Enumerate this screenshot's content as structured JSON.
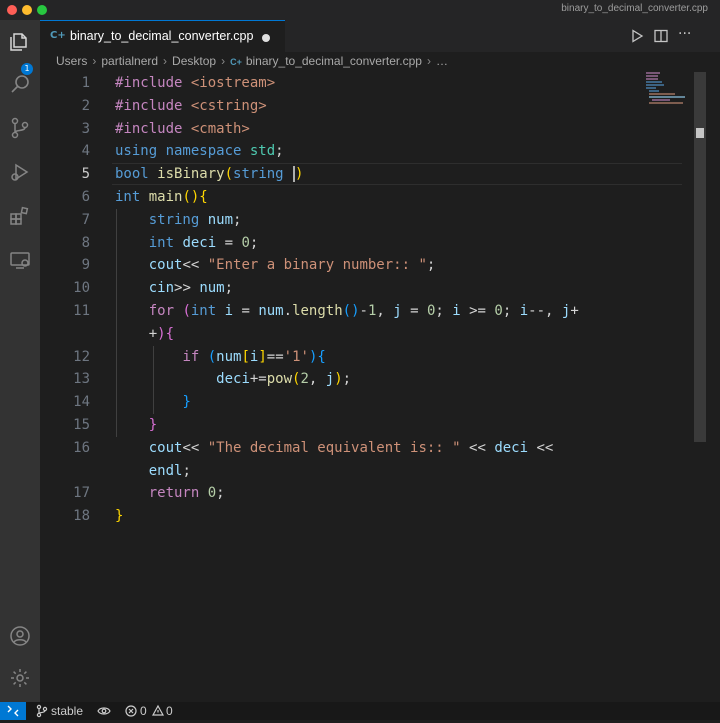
{
  "window": {
    "title": "binary_to_decimal_converter.cpp"
  },
  "activity_bar": {
    "explorer_badge": "1"
  },
  "tab": {
    "lang_icon": "C+",
    "label": "binary_to_decimal_converter.cpp",
    "dirty": true
  },
  "toolbar": {
    "more_label": "···"
  },
  "breadcrumb": {
    "items": [
      "Users",
      "partialnerd",
      "Desktop",
      "binary_to_decimal_converter.cpp",
      "…"
    ],
    "file_icon": "C+"
  },
  "editor": {
    "line_numbers": [
      "1",
      "2",
      "3",
      "4",
      "5",
      "6",
      "7",
      "8",
      "9",
      "10",
      "11",
      "",
      "12",
      "13",
      "14",
      "15",
      "16",
      "",
      "17",
      "18"
    ],
    "active_line": "5",
    "lines": [
      [
        [
          "pp",
          "#include "
        ],
        [
          "st",
          "<iostream>"
        ]
      ],
      [
        [
          "pp",
          "#include "
        ],
        [
          "st",
          "<cstring>"
        ]
      ],
      [
        [
          "pp",
          "#include "
        ],
        [
          "st",
          "<cmath>"
        ]
      ],
      [
        [
          "kw",
          "using "
        ],
        [
          "kw",
          "namespace "
        ],
        [
          "ns",
          "std"
        ],
        [
          "op",
          ";"
        ]
      ],
      [
        [
          "kw",
          "bool "
        ],
        [
          "fn",
          "isBinary"
        ],
        [
          "p1",
          "("
        ],
        [
          "kw",
          "string "
        ],
        [
          "p1",
          ")"
        ]
      ],
      [
        [
          "kw",
          "int "
        ],
        [
          "fn",
          "main"
        ],
        [
          "p1",
          "()"
        ],
        [
          "p1",
          "{"
        ]
      ],
      [
        [
          "op",
          "    "
        ],
        [
          "kw",
          "string "
        ],
        [
          "va",
          "num"
        ],
        [
          "op",
          ";"
        ]
      ],
      [
        [
          "op",
          "    "
        ],
        [
          "kw",
          "int "
        ],
        [
          "va",
          "deci"
        ],
        [
          "op",
          " = "
        ],
        [
          "nu",
          "0"
        ],
        [
          "op",
          ";"
        ]
      ],
      [
        [
          "op",
          "    "
        ],
        [
          "va",
          "cout"
        ],
        [
          "op",
          "<< "
        ],
        [
          "st",
          "\"Enter a binary number:: \""
        ],
        [
          "op",
          ";"
        ]
      ],
      [
        [
          "op",
          "    "
        ],
        [
          "va",
          "cin"
        ],
        [
          "op",
          ">> "
        ],
        [
          "va",
          "num"
        ],
        [
          "op",
          ";"
        ]
      ],
      [
        [
          "op",
          "    "
        ],
        [
          "pp",
          "for "
        ],
        [
          "p2",
          "("
        ],
        [
          "kw",
          "int "
        ],
        [
          "va",
          "i"
        ],
        [
          "op",
          " = "
        ],
        [
          "va",
          "num"
        ],
        [
          "op",
          "."
        ],
        [
          "fn",
          "length"
        ],
        [
          "p3",
          "()"
        ],
        [
          "op",
          "-"
        ],
        [
          "nu",
          "1"
        ],
        [
          "op",
          ", "
        ],
        [
          "va",
          "j"
        ],
        [
          "op",
          " = "
        ],
        [
          "nu",
          "0"
        ],
        [
          "op",
          "; "
        ],
        [
          "va",
          "i"
        ],
        [
          "op",
          " >= "
        ],
        [
          "nu",
          "0"
        ],
        [
          "op",
          "; "
        ],
        [
          "va",
          "i"
        ],
        [
          "op",
          "--, "
        ],
        [
          "va",
          "j"
        ],
        [
          "op",
          "+"
        ]
      ],
      [
        [
          "op",
          "    +"
        ],
        [
          "p2",
          ")"
        ],
        [
          "p2",
          "{"
        ]
      ],
      [
        [
          "op",
          "        "
        ],
        [
          "pp",
          "if "
        ],
        [
          "p3",
          "("
        ],
        [
          "va",
          "num"
        ],
        [
          "p1",
          "["
        ],
        [
          "va",
          "i"
        ],
        [
          "p1",
          "]"
        ],
        [
          "op",
          "=="
        ],
        [
          "st",
          "'1'"
        ],
        [
          "p3",
          ")"
        ],
        [
          "p3",
          "{"
        ]
      ],
      [
        [
          "op",
          "            "
        ],
        [
          "va",
          "deci"
        ],
        [
          "op",
          "+="
        ],
        [
          "fn",
          "pow"
        ],
        [
          "p1",
          "("
        ],
        [
          "nu",
          "2"
        ],
        [
          "op",
          ", "
        ],
        [
          "va",
          "j"
        ],
        [
          "p1",
          ")"
        ],
        [
          "op",
          ";"
        ]
      ],
      [
        [
          "op",
          "        "
        ],
        [
          "p3",
          "}"
        ]
      ],
      [
        [
          "op",
          "    "
        ],
        [
          "p2",
          "}"
        ]
      ],
      [
        [
          "op",
          "    "
        ],
        [
          "va",
          "cout"
        ],
        [
          "op",
          "<< "
        ],
        [
          "st",
          "\"The decimal equivalent is:: \""
        ],
        [
          "op",
          " << "
        ],
        [
          "va",
          "deci"
        ],
        [
          "op",
          " <<"
        ]
      ],
      [
        [
          "op",
          "    "
        ],
        [
          "va",
          "endl"
        ],
        [
          "op",
          ";"
        ]
      ],
      [
        [
          "op",
          "    "
        ],
        [
          "pp",
          "return "
        ],
        [
          "nu",
          "0"
        ],
        [
          "op",
          ";"
        ]
      ],
      [
        [
          "p1",
          "}"
        ]
      ]
    ]
  },
  "statusbar": {
    "branch": "stable",
    "errors": "0",
    "warnings": "0"
  },
  "colors": {
    "accent": "#0078d4",
    "editor_bg": "#1e1e1e",
    "activity_bg": "#333333"
  }
}
